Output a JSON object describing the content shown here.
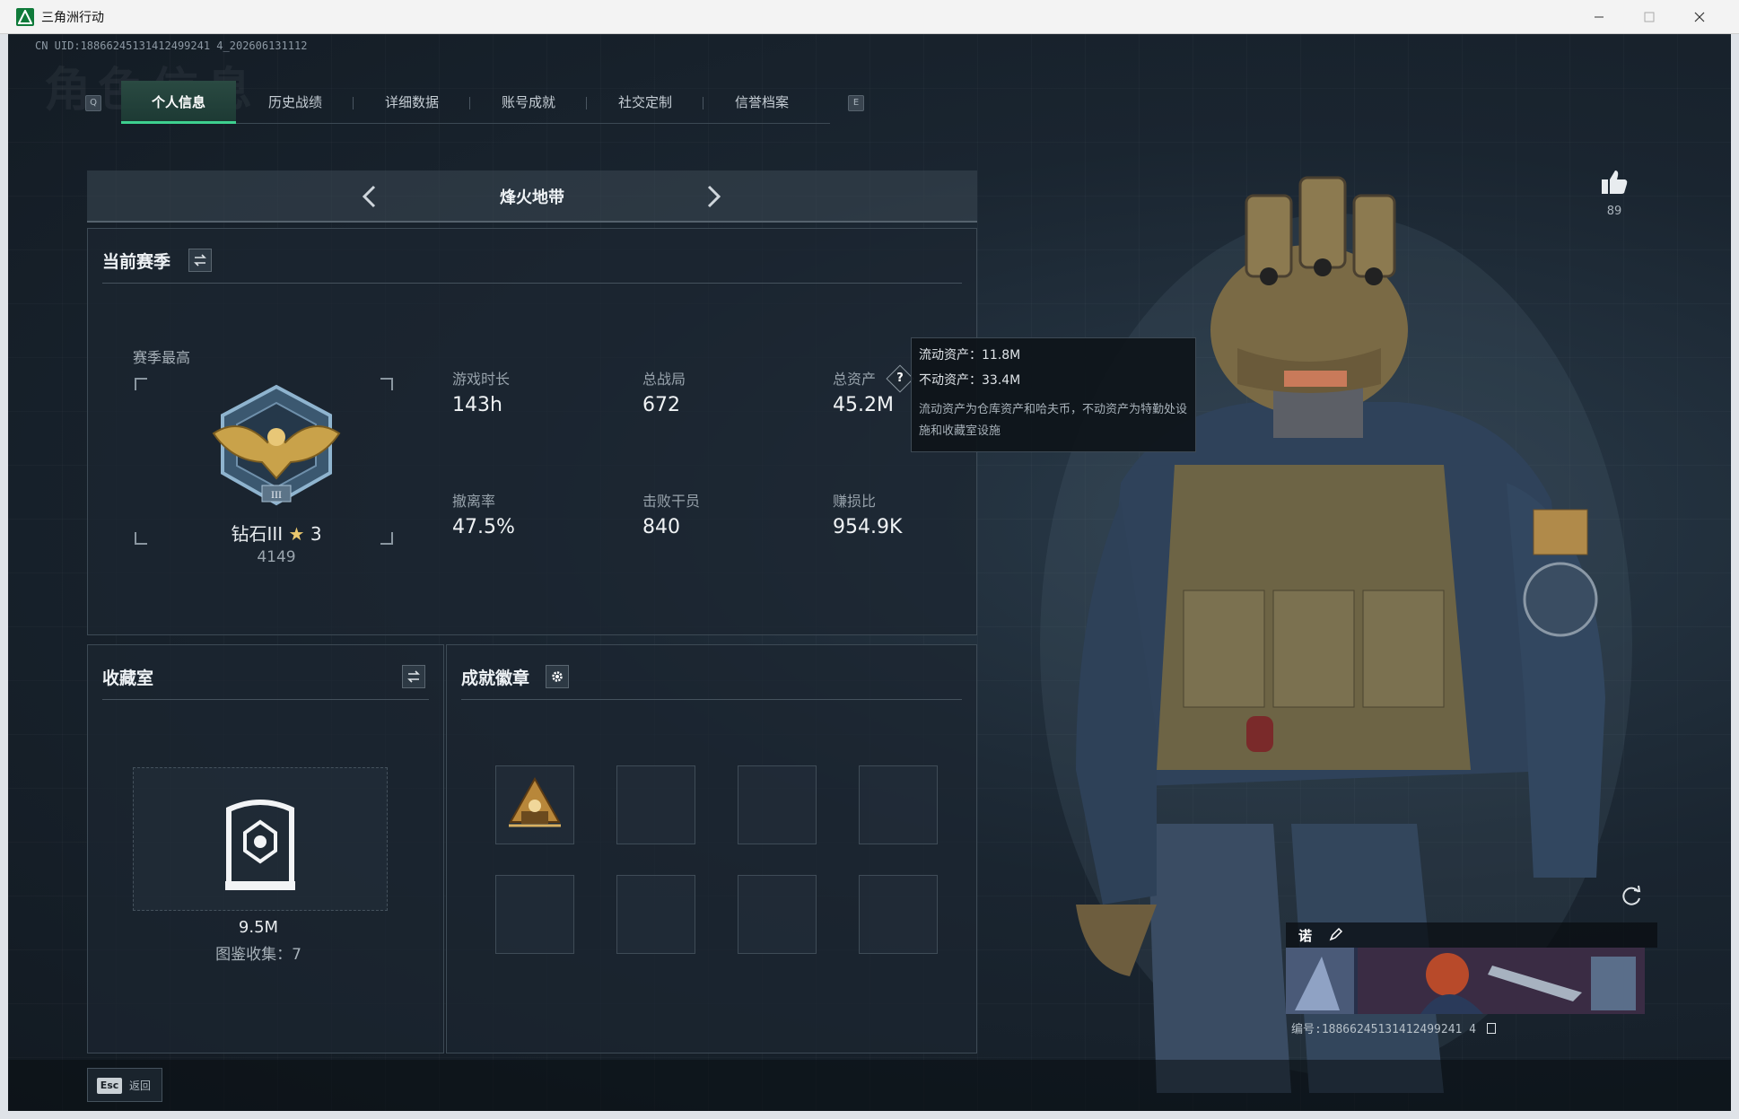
{
  "window": {
    "title": "三角洲行动"
  },
  "uid_line": "CN UID:18866245131412499241 4_202606131112",
  "ghost_title": "角色信息",
  "key_hints": {
    "left": "Q",
    "right": "E"
  },
  "tabs": [
    {
      "label": "个人信息",
      "active": true
    },
    {
      "label": "历史战绩",
      "active": false
    },
    {
      "label": "详细数据",
      "active": false
    },
    {
      "label": "账号成就",
      "active": false
    },
    {
      "label": "社交定制",
      "active": false
    },
    {
      "label": "信誉档案",
      "active": false
    }
  ],
  "mode": {
    "name": "烽火地带"
  },
  "season": {
    "title": "当前赛季",
    "best_label": "赛季最高",
    "rank_name": "钻石III",
    "rank_star_glyph": "★",
    "rank_stars": "3",
    "rank_score": "4149",
    "stats": [
      {
        "label": "游戏时长",
        "value": "143h"
      },
      {
        "label": "总战局",
        "value": "672"
      },
      {
        "label": "总资产",
        "value": "45.2M"
      },
      {
        "label": "撤离率",
        "value": "47.5%"
      },
      {
        "label": "击败干员",
        "value": "840"
      },
      {
        "label": "赚损比",
        "value": "954.9K"
      }
    ],
    "help_glyph": "?"
  },
  "tooltip": {
    "liquid": "流动资产：11.8M",
    "fixed": "不动资产：33.4M",
    "desc": "流动资产为仓库资产和哈夫币，不动资产为特勤处设施和收藏室设施"
  },
  "collection": {
    "title": "收藏室",
    "value": "9.5M",
    "count": "图鉴收集：7"
  },
  "badges": {
    "title": "成就徽章",
    "slots": 8,
    "filled": 1
  },
  "likes": {
    "count": "89"
  },
  "namecard": {
    "name": "诺",
    "id": "编号:18866245131412499241 4"
  },
  "esc": {
    "key": "Esc",
    "label": "返回"
  },
  "colors": {
    "accent": "#3ed08f",
    "panel": "#1c2630",
    "text": "#eef2f5"
  }
}
